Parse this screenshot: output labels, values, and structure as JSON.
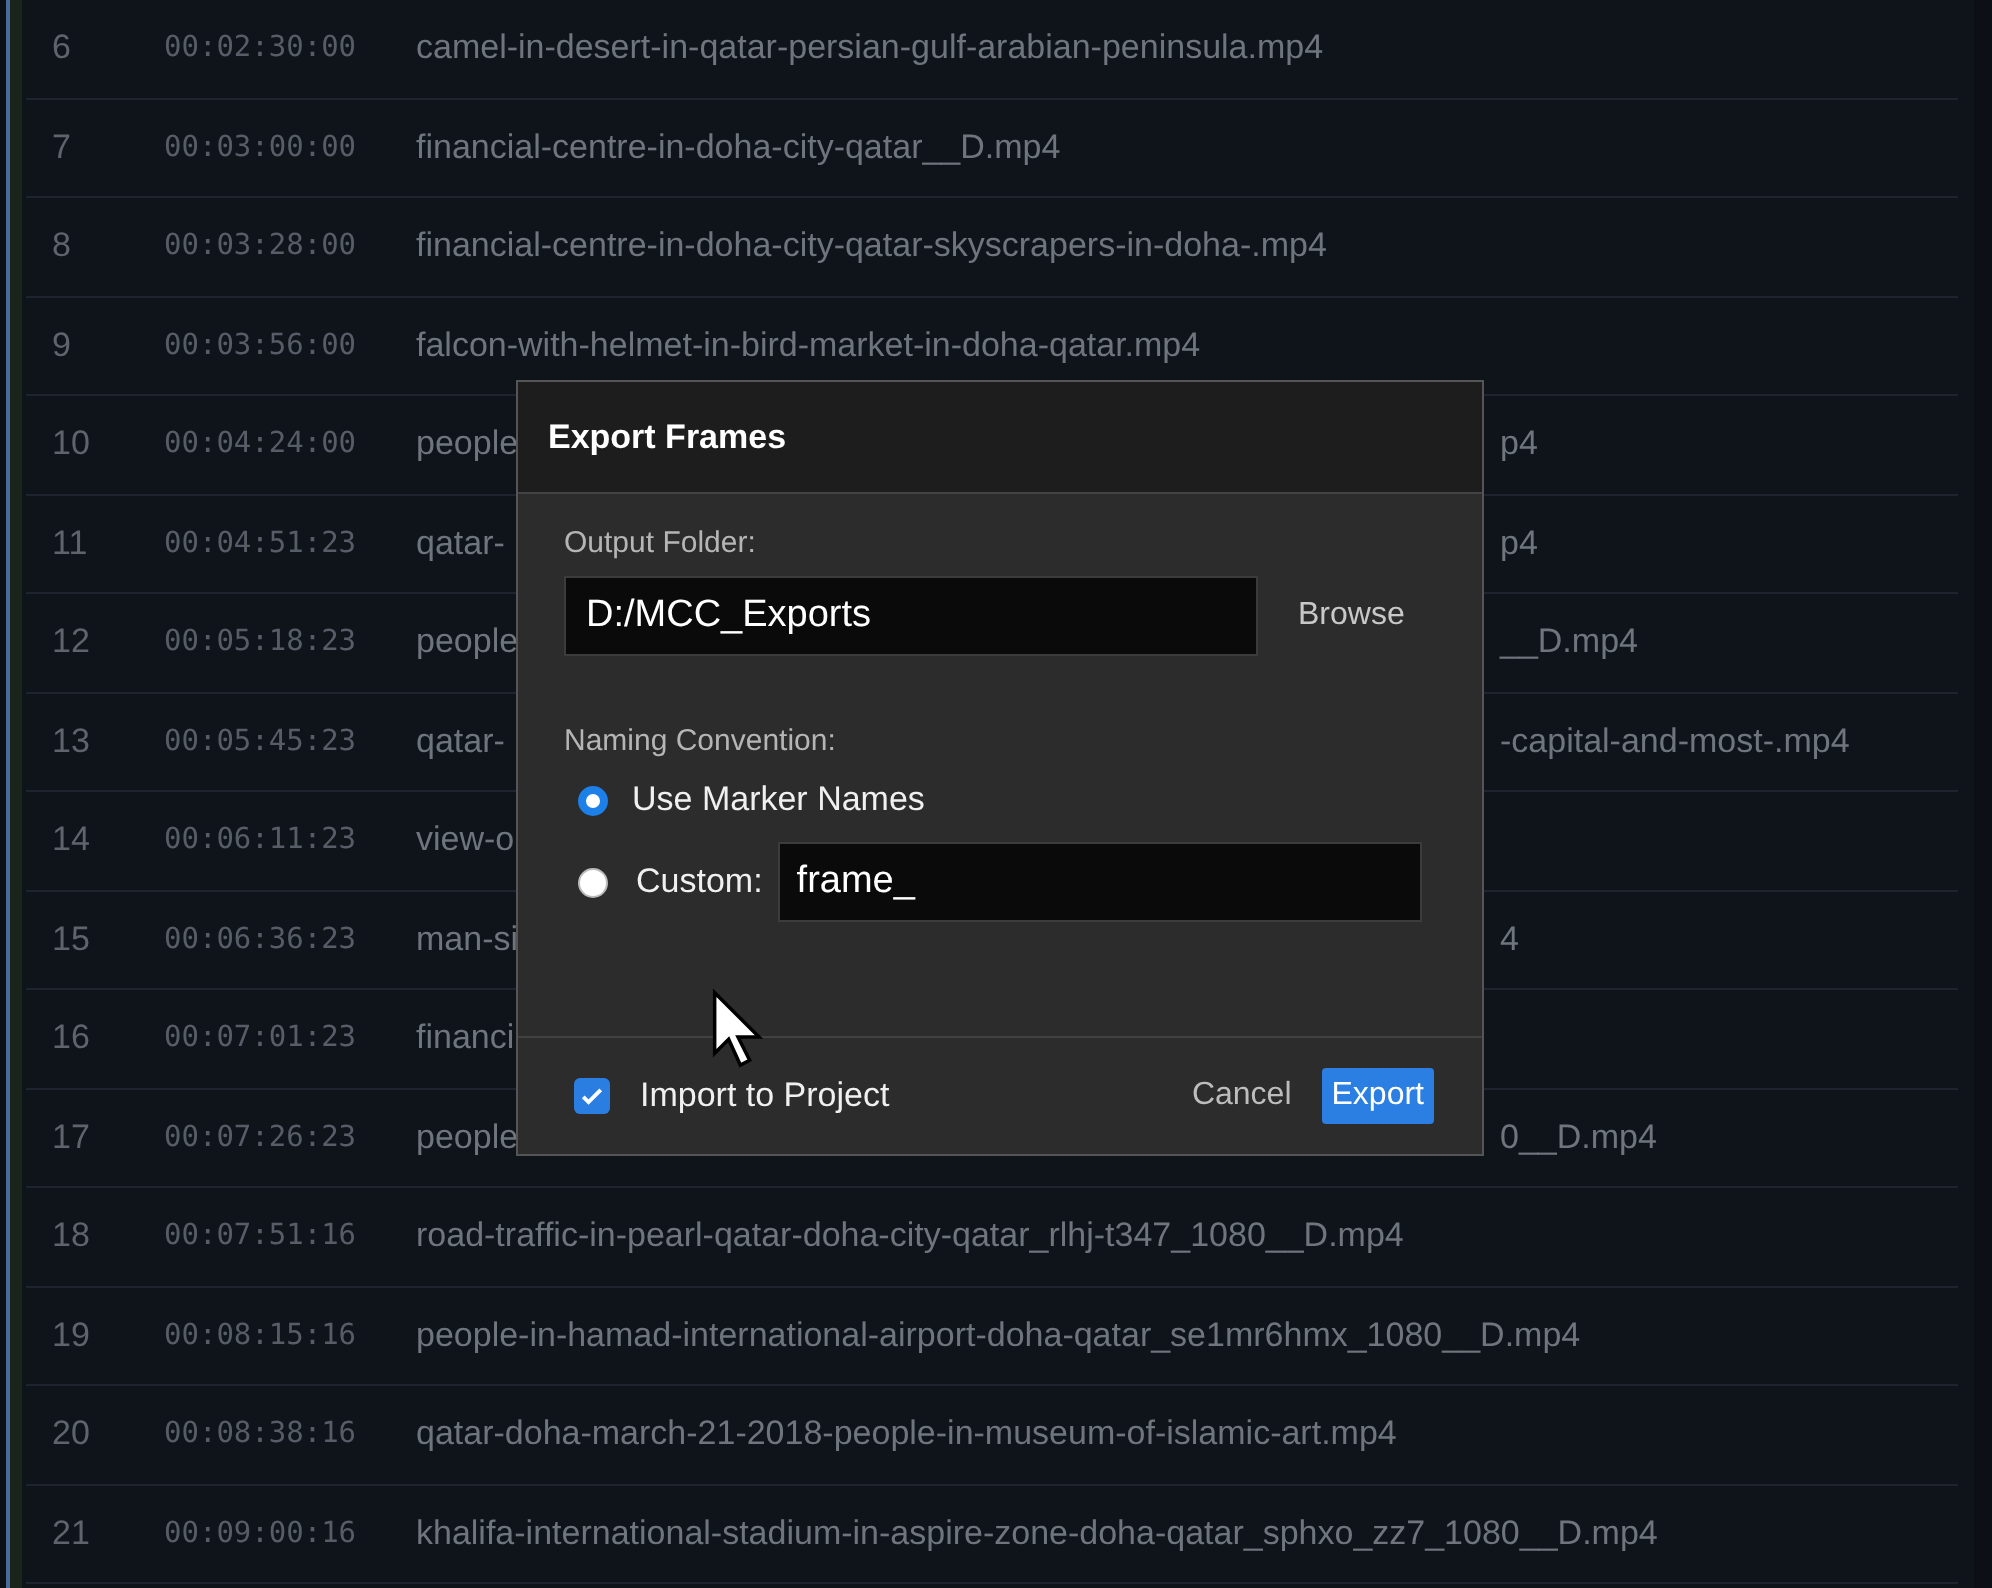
{
  "rows": [
    {
      "number": "6",
      "timecode": "00:02:30:00",
      "name": "camel-in-desert-in-qatar-persian-gulf-arabian-peninsula.mp4"
    },
    {
      "number": "7",
      "timecode": "00:03:00:00",
      "name": "financial-centre-in-doha-city-qatar__D.mp4"
    },
    {
      "number": "8",
      "timecode": "00:03:28:00",
      "name": "financial-centre-in-doha-city-qatar-skyscrapers-in-doha-.mp4"
    },
    {
      "number": "9",
      "timecode": "00:03:56:00",
      "name": "falcon-with-helmet-in-bird-market-in-doha-qatar.mp4"
    },
    {
      "number": "10",
      "timecode": "00:04:24:00",
      "name": "people",
      "name_tail": "p4"
    },
    {
      "number": "11",
      "timecode": "00:04:51:23",
      "name": "qatar-",
      "name_tail": "p4"
    },
    {
      "number": "12",
      "timecode": "00:05:18:23",
      "name": "people",
      "name_tail": "__D.mp4"
    },
    {
      "number": "13",
      "timecode": "00:05:45:23",
      "name": "qatar-",
      "name_tail": "-capital-and-most-.mp4"
    },
    {
      "number": "14",
      "timecode": "00:06:11:23",
      "name": "view-o"
    },
    {
      "number": "15",
      "timecode": "00:06:36:23",
      "name": "man-si",
      "name_tail": "4"
    },
    {
      "number": "16",
      "timecode": "00:07:01:23",
      "name": "financi"
    },
    {
      "number": "17",
      "timecode": "00:07:26:23",
      "name": "people",
      "name_tail": "0__D.mp4"
    },
    {
      "number": "18",
      "timecode": "00:07:51:16",
      "name": "road-traffic-in-pearl-qatar-doha-city-qatar_rlhj-t347_1080__D.mp4"
    },
    {
      "number": "19",
      "timecode": "00:08:15:16",
      "name": "people-in-hamad-international-airport-doha-qatar_se1mr6hmx_1080__D.mp4"
    },
    {
      "number": "20",
      "timecode": "00:08:38:16",
      "name": "qatar-doha-march-21-2018-people-in-museum-of-islamic-art.mp4"
    },
    {
      "number": "21",
      "timecode": "00:09:00:16",
      "name": "khalifa-international-stadium-in-aspire-zone-doha-qatar_sphxo_zz7_1080__D.mp4"
    }
  ],
  "dialog": {
    "title": "Export Frames",
    "output_folder_label": "Output Folder:",
    "output_folder": "D:/MCC_Exports",
    "browse_button": "Browse",
    "naming_label": "Naming Convention:",
    "options": [
      {
        "kind": "plain",
        "label": "Use Marker Names",
        "selected": true
      },
      {
        "kind": "custom",
        "label": "Custom:",
        "selected": false,
        "value": "frame_"
      }
    ],
    "import": {
      "label": "Import to Project",
      "checked": true
    },
    "buttons": [
      {
        "kind": "secondary",
        "label": "Cancel"
      },
      {
        "kind": "primary",
        "label": "Export"
      }
    ]
  }
}
